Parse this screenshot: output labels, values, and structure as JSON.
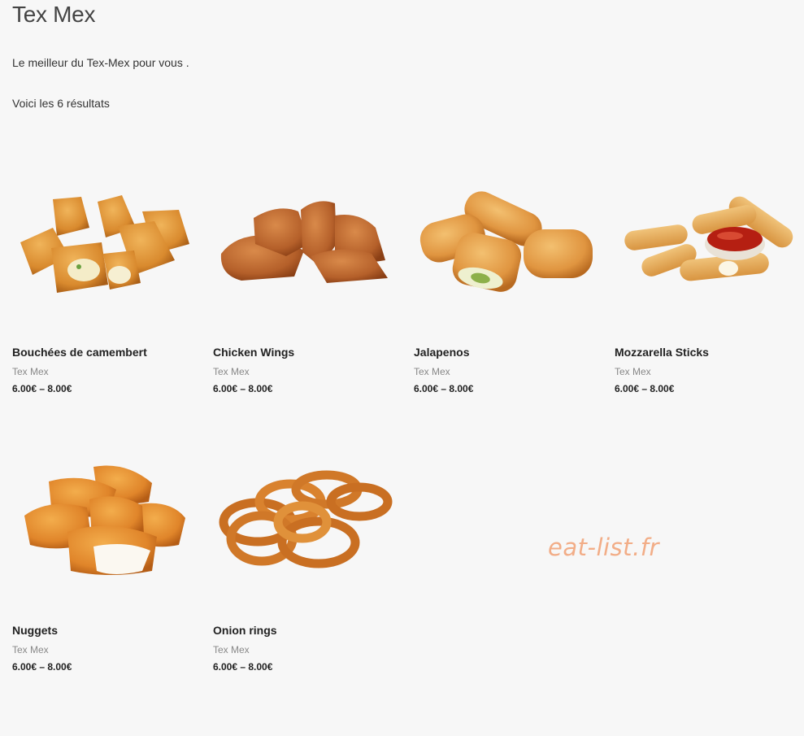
{
  "page": {
    "title": "Tex Mex",
    "intro": "Le meilleur du Tex-Mex pour vous .",
    "results_text": "Voici les 6 résultats"
  },
  "products": [
    {
      "name": "Bouchées de camembert",
      "category": "Tex Mex",
      "price": "6.00€ – 8.00€",
      "image": "camembert-bites-image"
    },
    {
      "name": "Chicken Wings",
      "category": "Tex Mex",
      "price": "6.00€ – 8.00€",
      "image": "chicken-wings-image"
    },
    {
      "name": "Jalapenos",
      "category": "Tex Mex",
      "price": "6.00€ – 8.00€",
      "image": "jalapenos-image"
    },
    {
      "name": "Mozzarella Sticks",
      "category": "Tex Mex",
      "price": "6.00€ – 8.00€",
      "image": "mozzarella-sticks-image"
    },
    {
      "name": "Nuggets",
      "category": "Tex Mex",
      "price": "6.00€ – 8.00€",
      "image": "nuggets-image"
    },
    {
      "name": "Onion rings",
      "category": "Tex Mex",
      "price": "6.00€ – 8.00€",
      "image": "onion-rings-image"
    }
  ],
  "watermark": "eat-list.fr",
  "colors": {
    "background": "#f7f7f7",
    "fried_food": "#d98a2e",
    "watermark": "#f2ad87"
  }
}
